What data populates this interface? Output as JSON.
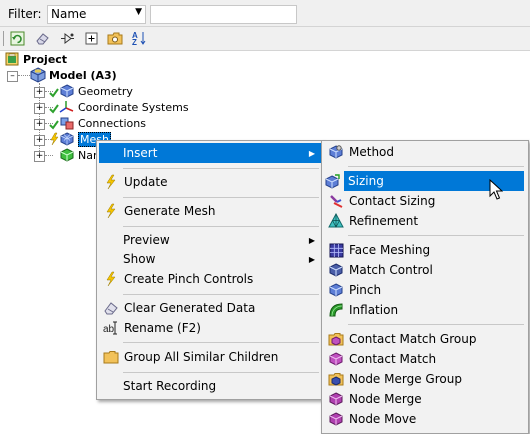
{
  "filter": {
    "label": "Filter:",
    "selected": "Name",
    "search_value": ""
  },
  "toolbar": {
    "icons": [
      "refresh-icon",
      "clear-icon",
      "connect-icon",
      "expand-icon",
      "folder-icon",
      "sort-az-icon"
    ]
  },
  "tree": {
    "project": "Project",
    "model": "Model (A3)",
    "items": [
      {
        "label": "Geometry",
        "icon": "geometry-icon"
      },
      {
        "label": "Coordinate Systems",
        "icon": "axis-icon"
      },
      {
        "label": "Connections",
        "icon": "connections-icon"
      },
      {
        "label": "Mesh",
        "icon": "mesh-icon",
        "selected": true
      },
      {
        "label": "Nar",
        "icon": "named-selections-icon"
      }
    ]
  },
  "context_menu": {
    "items": [
      {
        "label": "Insert",
        "submenu": true,
        "highlighted": true
      },
      {
        "label": "Update",
        "icon": "lightning-icon"
      },
      {
        "label": "Generate Mesh",
        "icon": "lightning-icon"
      },
      {
        "label": "Preview",
        "submenu": true
      },
      {
        "label": "Show",
        "submenu": true
      },
      {
        "label": "Create Pinch Controls",
        "icon": "lightning-icon"
      },
      {
        "label": "Clear Generated Data",
        "icon": "eraser-icon"
      },
      {
        "label": "Rename (F2)",
        "icon": "rename-icon"
      },
      {
        "label": "Group All Similar Children",
        "icon": "folder-icon"
      },
      {
        "label": "Start Recording"
      }
    ]
  },
  "submenu": {
    "items": [
      {
        "label": "Method",
        "icon": "method-icon"
      },
      {
        "label": "Sizing",
        "icon": "sizing-icon",
        "highlighted": true
      },
      {
        "label": "Contact Sizing",
        "icon": "contact-sizing-icon"
      },
      {
        "label": "Refinement",
        "icon": "refinement-icon"
      },
      {
        "label": "Face Meshing",
        "icon": "face-meshing-icon"
      },
      {
        "label": "Match Control",
        "icon": "match-control-icon"
      },
      {
        "label": "Pinch",
        "icon": "pinch-icon"
      },
      {
        "label": "Inflation",
        "icon": "inflation-icon"
      },
      {
        "label": "Contact Match Group",
        "icon": "contact-match-group-icon"
      },
      {
        "label": "Contact Match",
        "icon": "contact-match-icon"
      },
      {
        "label": "Node Merge Group",
        "icon": "node-merge-group-icon"
      },
      {
        "label": "Node Merge",
        "icon": "node-merge-icon"
      },
      {
        "label": "Node Move",
        "icon": "node-move-icon"
      }
    ]
  },
  "colors": {
    "highlight": "#0078d7",
    "menu_bg": "#f2f2f2",
    "lightning": "#f5c400",
    "check": "#2ea12e"
  }
}
